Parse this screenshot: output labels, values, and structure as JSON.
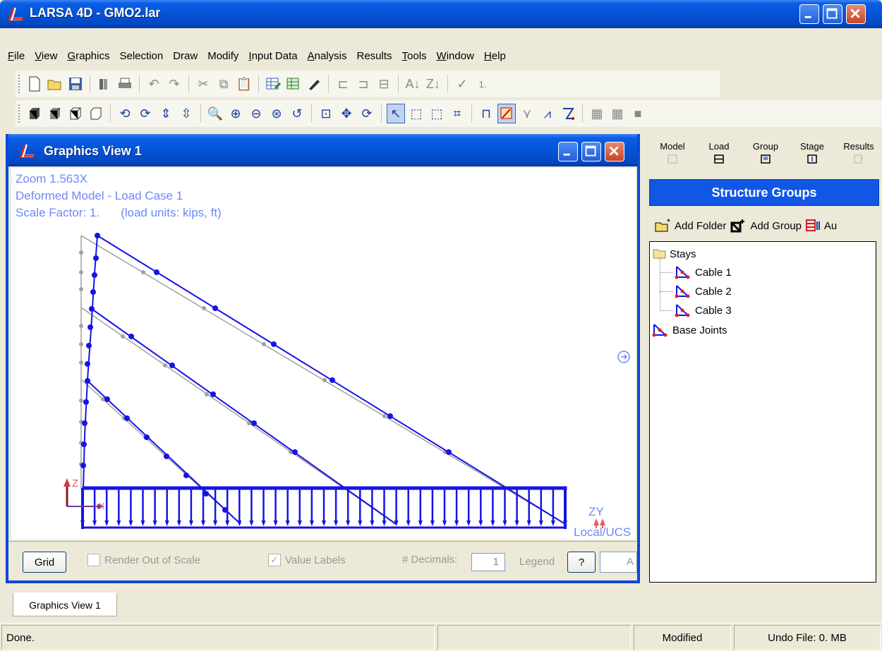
{
  "window": {
    "title": "LARSA 4D - GMO2.lar"
  },
  "menu": {
    "items": [
      {
        "label": "File",
        "key": "F"
      },
      {
        "label": "View",
        "key": "V"
      },
      {
        "label": "Graphics",
        "key": "G"
      },
      {
        "label": "Selection",
        "key": "S"
      },
      {
        "label": "Draw",
        "key": "D"
      },
      {
        "label": "Modify",
        "key": "M"
      },
      {
        "label": "Input Data",
        "key": "I"
      },
      {
        "label": "Analysis",
        "key": "A"
      },
      {
        "label": "Results",
        "key": "R"
      },
      {
        "label": "Tools",
        "key": "T"
      },
      {
        "label": "Window",
        "key": "W"
      },
      {
        "label": "Help",
        "key": "H"
      }
    ]
  },
  "toolbar1": {
    "trailing_text": "1."
  },
  "graphics_view": {
    "title": "Graphics View 1",
    "zoom": "Zoom  1.563X",
    "mode": "Deformed Model - Load Case 1",
    "scale": "Scale Factor: 1.",
    "units": "(load units: kips, ft)",
    "axis_top": "ZY",
    "axis_label": "Local/UCS",
    "axis_z": "Z",
    "axis_x": "X",
    "footer": {
      "grid_label": "Grid",
      "render_out_of_scale": "Render Out of Scale",
      "value_labels": "Value Labels",
      "value_labels_checked": "✓",
      "decimals_label": "# Decimals:",
      "decimals_value": "1",
      "legend_label": "Legend",
      "help_label": "?",
      "legend_value": "A"
    }
  },
  "right_panel": {
    "tabs": [
      {
        "label": "Model",
        "icon": "model-icon"
      },
      {
        "label": "Load",
        "icon": "load-icon"
      },
      {
        "label": "Group",
        "icon": "group-icon"
      },
      {
        "label": "Stage",
        "icon": "stage-icon"
      },
      {
        "label": "Results",
        "icon": "results-icon"
      }
    ],
    "header": "Structure Groups",
    "toolbar": {
      "add_folder": "Add Folder",
      "add_group": "Add Group",
      "add_third": "Au"
    },
    "tree": {
      "folder": "Stays",
      "children": [
        "Cable 1",
        "Cable 2",
        "Cable 3"
      ],
      "root_item": "Base Joints"
    }
  },
  "mdi_tab": {
    "label": "Graphics View 1"
  },
  "status": {
    "message": "Done.",
    "middle": "",
    "modified": "Modified",
    "undo": "Undo File: 0. MB"
  },
  "colors": {
    "xp_blue": "#0453D7",
    "model_blue": "#1414E6",
    "undeformed_gray": "#A0A0A0",
    "overlay_text": "#6E88F6"
  }
}
